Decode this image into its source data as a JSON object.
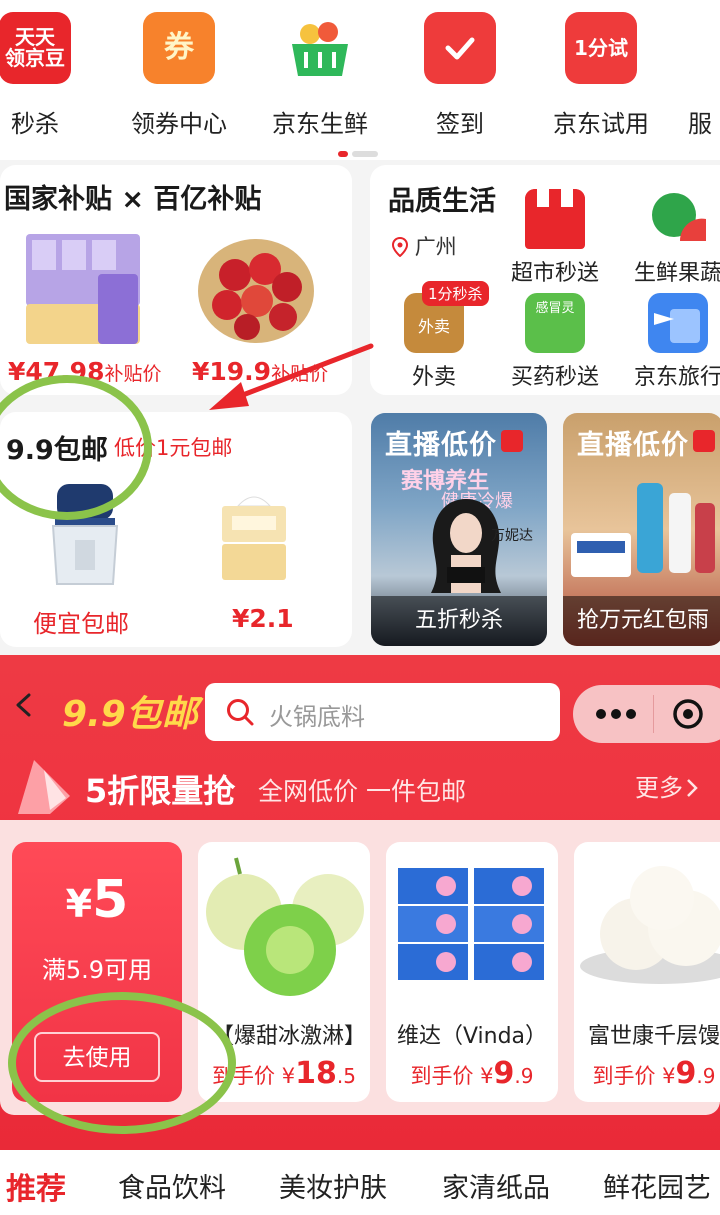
{
  "categories": [
    {
      "label": "秒杀",
      "icon": "tiantian-jingdou-icon",
      "icon_text": "天天\n领京豆",
      "color": "#e8262b"
    },
    {
      "label": "领券中心",
      "icon": "coupon-ticket-icon",
      "icon_text": "券",
      "color": "#f7822c"
    },
    {
      "label": "京东生鲜",
      "icon": "fresh-basket-icon",
      "icon_text": "",
      "color": "#2fb85a"
    },
    {
      "label": "签到",
      "icon": "calendar-check-icon",
      "icon_text": "",
      "color": "#ee3b3b"
    },
    {
      "label": "京东试用",
      "icon": "trial-bag-icon",
      "icon_text": "1分试",
      "color": "#ee3b3b"
    },
    {
      "label": "服",
      "icon": "service-icon",
      "icon_text": "",
      "color": "#e8262b"
    }
  ],
  "subsidy": {
    "title": "国家补贴 × 百亿补贴",
    "items": [
      {
        "price": "¥47.98",
        "suffix": "补贴价"
      },
      {
        "price": "¥19.9",
        "suffix": "补贴价"
      }
    ]
  },
  "quality": {
    "title": "品质生活",
    "location": "广州",
    "services": [
      {
        "label": "超市秒送",
        "icon": "supermarket-icon"
      },
      {
        "label": "生鲜果蔬",
        "icon": "vegetable-icon"
      },
      {
        "label": "外卖",
        "icon": "takeout-icon",
        "badge": "1分秒杀",
        "icon_text": "外卖"
      },
      {
        "label": "买药秒送",
        "icon": "medicine-icon",
        "icon_text": "感冒灵"
      },
      {
        "label": "京东旅行",
        "icon": "travel-icon"
      }
    ]
  },
  "nine": {
    "title": "9.9包邮",
    "subtitle": "低价1元包邮",
    "items": [
      {
        "label": "便宜包邮"
      },
      {
        "label": "¥2.1"
      }
    ]
  },
  "live": [
    {
      "title": "直播低价",
      "bottom": "五折秒杀",
      "overlay1": "赛博养生",
      "overlay2": "健康冷爆",
      "host": "万妮达"
    },
    {
      "title": "直播低价",
      "bottom": "抢万元红包雨"
    }
  ],
  "panel": {
    "title": "9.9包邮",
    "search_placeholder": "火锅底料",
    "banner_title": "5折限量抢",
    "banner_sub": "全网低价 一件包邮",
    "more": "更多",
    "coupon": {
      "currency": "¥",
      "amount": "5",
      "condition": "满5.9可用",
      "button": "去使用"
    },
    "products": [
      {
        "name": "【爆甜冰激淋】",
        "price_label": "到手价",
        "currency": "¥",
        "price_int": "18",
        "price_dec": ".5"
      },
      {
        "name": "维达（Vinda）",
        "price_label": "到手价",
        "currency": "¥",
        "price_int": "9",
        "price_dec": ".9"
      },
      {
        "name": "富世康千层馒",
        "price_label": "到手价",
        "currency": "¥",
        "price_int": "9",
        "price_dec": ".9"
      }
    ]
  },
  "tabs": [
    "推荐",
    "食品饮料",
    "美妆护肤",
    "家清纸品",
    "鲜花园艺"
  ],
  "colors": {
    "accent": "#e8262b",
    "annotation": "#8bc34a",
    "title_yellow": "#ffd84a"
  }
}
